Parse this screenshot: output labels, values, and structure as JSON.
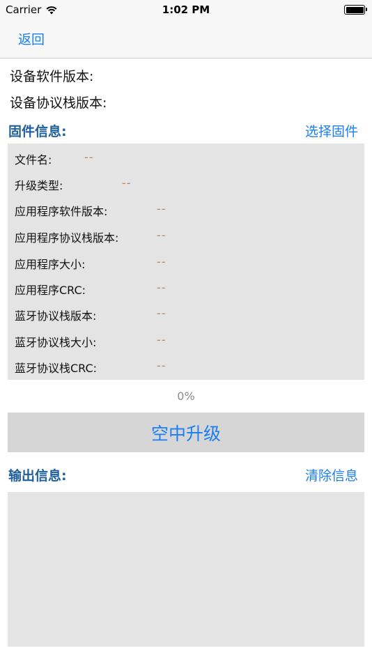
{
  "status_bar": {
    "carrier": "Carrier",
    "time": "1:02 PM",
    "icons": [
      "wifi-icon",
      "battery-icon"
    ]
  },
  "nav": {
    "back_label": "返回"
  },
  "device": {
    "software_version_label": "设备软件版本:",
    "stack_version_label": "设备协议栈版本:"
  },
  "firmware": {
    "title": "固件信息:",
    "select_label": "选择固件",
    "rows": [
      {
        "label": "文件名:",
        "value": "--"
      },
      {
        "label": "升级类型:",
        "value": "--"
      },
      {
        "label": "应用程序软件版本:",
        "value": "--"
      },
      {
        "label": "应用程序协议栈版本:",
        "value": "--"
      },
      {
        "label": "应用程序大小:",
        "value": "--"
      },
      {
        "label": "应用程序CRC:",
        "value": "--"
      },
      {
        "label": "蓝牙协议栈版本:",
        "value": "--"
      },
      {
        "label": "蓝牙协议栈大小:",
        "value": "--"
      },
      {
        "label": "蓝牙协议栈CRC:",
        "value": "--"
      }
    ]
  },
  "progress": {
    "text": "0%",
    "value": 0
  },
  "ota_button_label": "空中升级",
  "output": {
    "title": "输出信息:",
    "clear_label": "清除信息",
    "content": ""
  },
  "colors": {
    "accent": "#1a7ff5",
    "section_title": "#1f5f9a",
    "placeholder_value": "#b8845a",
    "panel": "#e4e4e4",
    "button_bg": "#d6d6d6"
  }
}
